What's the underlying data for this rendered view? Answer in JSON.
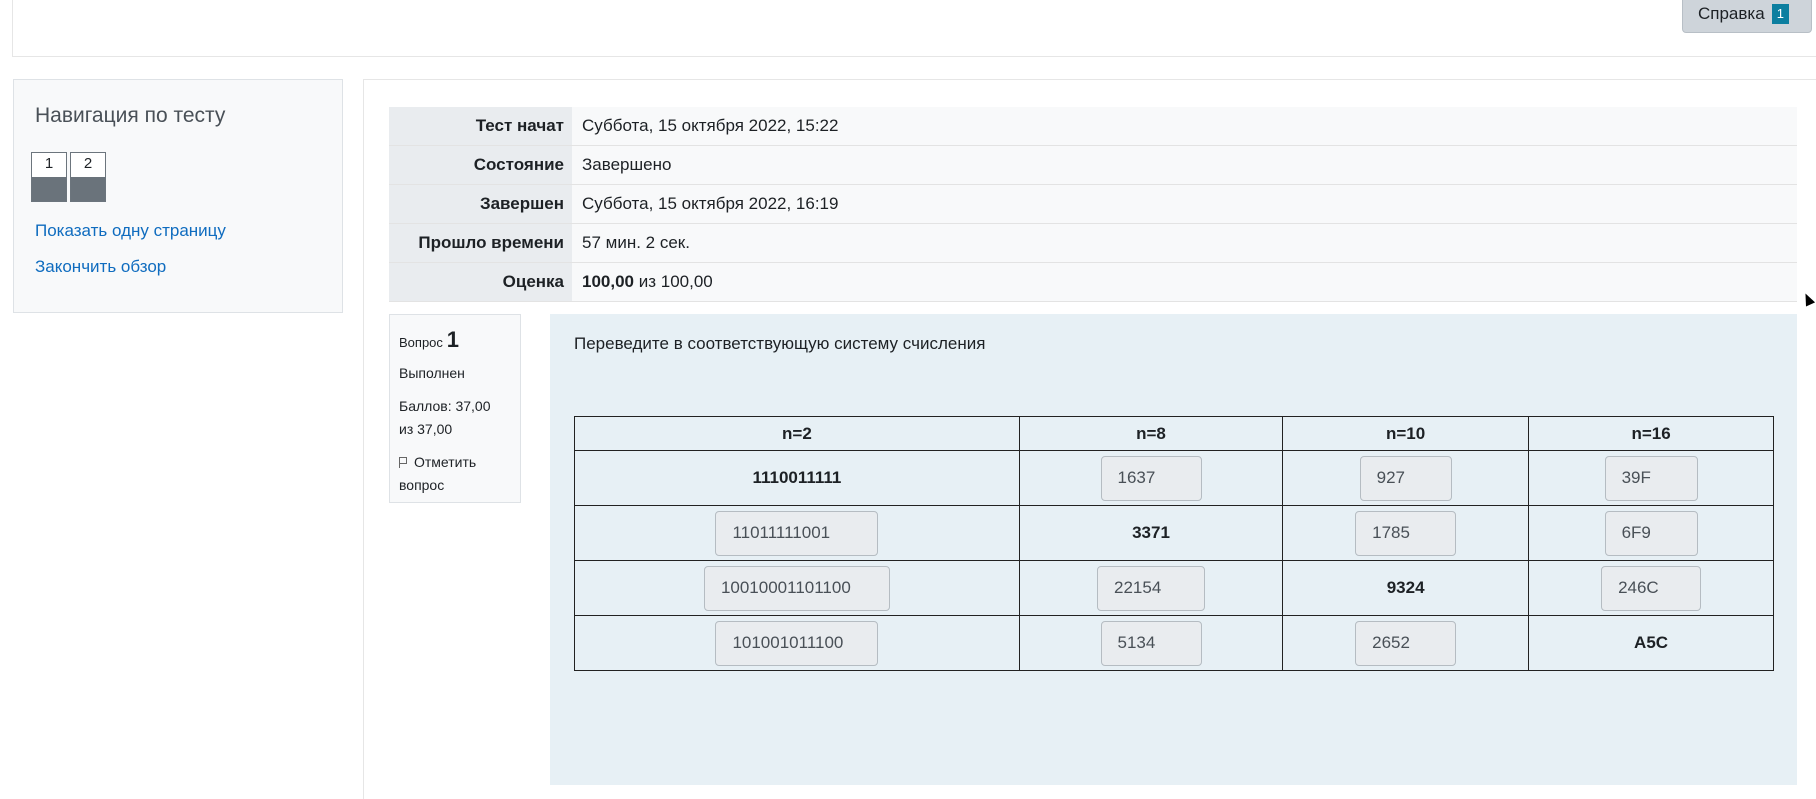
{
  "header": {
    "help_label": "Справка",
    "help_badge": "1"
  },
  "nav": {
    "title": "Навигация по тесту",
    "questions": [
      "1",
      "2"
    ],
    "show_one_page": "Показать одну страницу",
    "finish_review": "Закончить обзор"
  },
  "summary": {
    "started_label": "Тест начат",
    "started_value": "Суббота, 15 октября 2022, 15:22",
    "state_label": "Состояние",
    "state_value": "Завершено",
    "completed_label": "Завершен",
    "completed_value": "Суббота, 15 октября 2022, 16:19",
    "time_label": "Прошло времени",
    "time_value": "57 мин. 2 сек.",
    "grade_label": "Оценка",
    "grade_value": "100,00",
    "grade_suffix": "из 100,00"
  },
  "question": {
    "label": "Вопрос",
    "number": "1",
    "state": "Выполнен",
    "grade": "Баллов: 37,00 из 37,00",
    "flag_label": "Отметить вопрос",
    "text": "Переведите в соответствующую систему счисления",
    "headers": [
      "n=2",
      "n=8",
      "n=10",
      "n=16"
    ],
    "rows": [
      {
        "given": "1110011111",
        "a": "1637",
        "b": "927",
        "c": "39F"
      },
      {
        "a": "11011111001",
        "given": "3371",
        "b": "1785",
        "c": "6F9"
      },
      {
        "a": "10010001101100",
        "b": "22154",
        "given": "9324",
        "c": "246C"
      },
      {
        "a": "101001011100",
        "b": "5134",
        "c": "2652",
        "given": "A5C"
      }
    ]
  }
}
